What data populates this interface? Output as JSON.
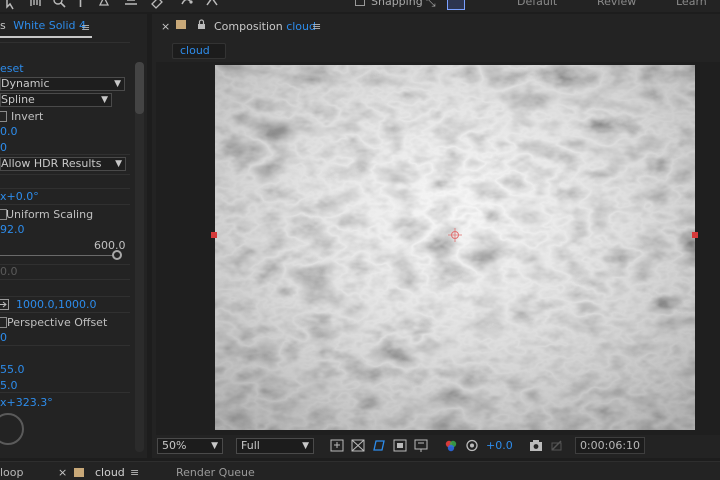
{
  "toolbar": {
    "snapping_label": "Snapping",
    "workspaces": [
      "Default",
      "Review",
      "Learn"
    ]
  },
  "effect_controls": {
    "tab_prefix": "s",
    "layer_name": "White Solid 4",
    "menu_icon": "≡",
    "reset_label": "eset",
    "fractal_type": "Dynamic",
    "interpolation": "Spline",
    "invert_label": "Invert",
    "contrast": "0.0",
    "brightness": "0",
    "overflow": "Allow HDR Results",
    "rotation": "x+0.0°",
    "uniform_scaling_label": "Uniform Scaling",
    "scale": "92.0",
    "slider_max": "600.0",
    "scale_width": "0.0",
    "offset_turbulence": "1000.0,1000.0",
    "perspective_offset_label": "Perspective Offset",
    "complexity": "0",
    "sub_influence": "55.0",
    "sub_scaling": "5.0",
    "evolution": "x+323.3°"
  },
  "composition": {
    "close_glyph": "×",
    "title_prefix": "Composition",
    "comp_name": "cloud",
    "menu_icon": "≡",
    "breadcrumb": "cloud",
    "zoom": "50%",
    "resolution": "Full",
    "exposure": "+0.0",
    "timecode": "0:00:06:10"
  },
  "bottom_tabs": {
    "first_tab": "loop",
    "close_glyph": "×",
    "comp_tab": "cloud",
    "menu_icon": "≡",
    "render_queue": "Render Queue"
  },
  "colors": {
    "accent_blue": "#2d8ceb",
    "keyframe_red": "#d63a3a",
    "panel_bg": "#232323",
    "comp_swatch": "#c8a878"
  }
}
